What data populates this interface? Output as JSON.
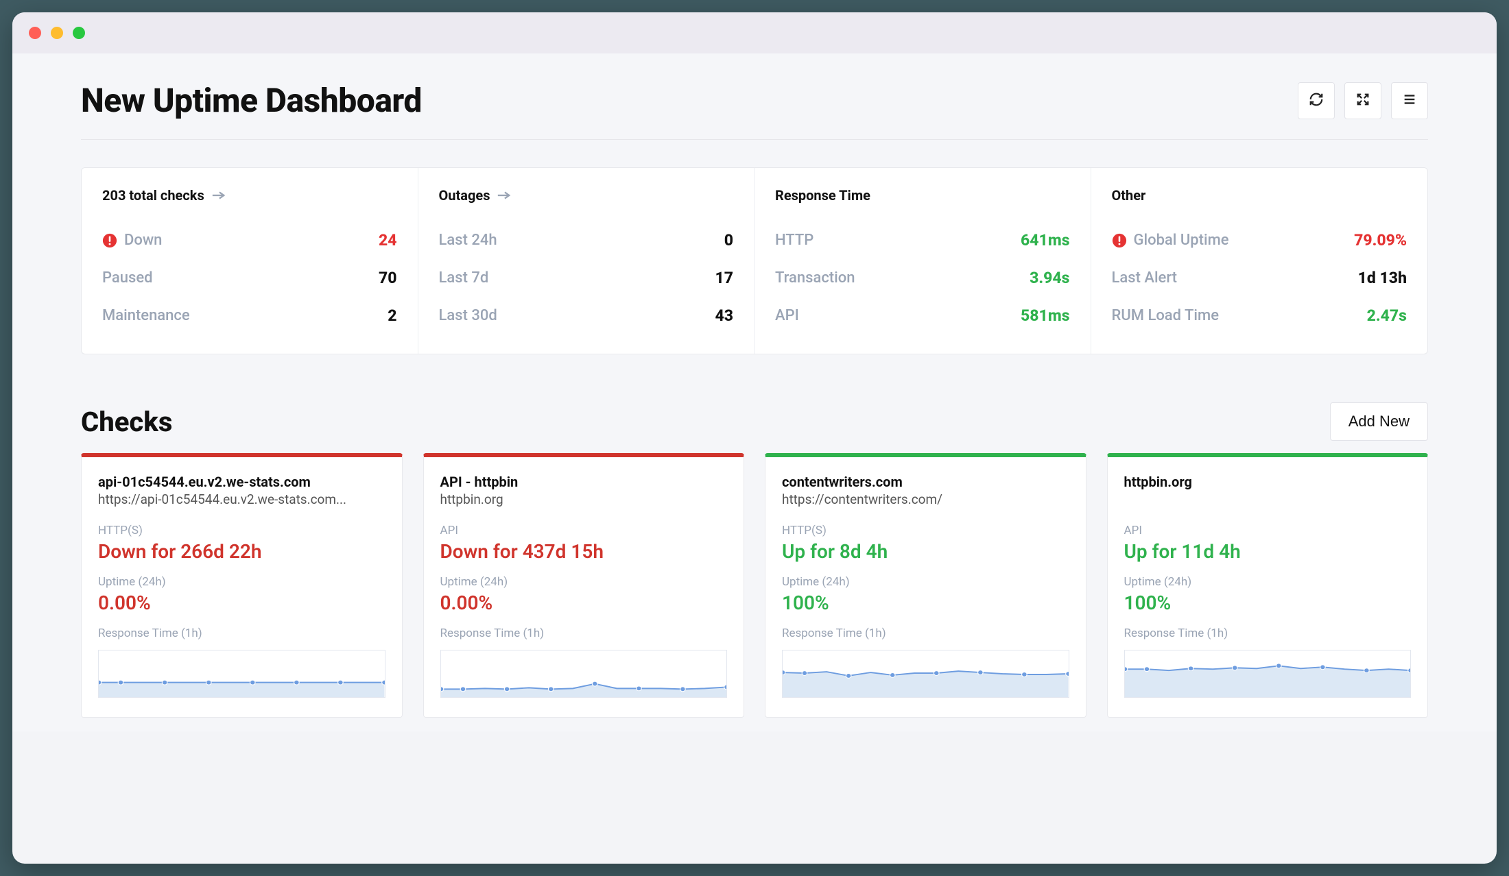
{
  "colors": {
    "red": "#e53333",
    "green": "#2fb24d",
    "down_border": "#d0342c",
    "up_border": "#2fb24d"
  },
  "header": {
    "title": "New Uptime Dashboard"
  },
  "summary": {
    "checks": {
      "title": "203 total checks",
      "rows": [
        {
          "label": "Down",
          "value": "24",
          "alert": true,
          "valueClass": "red"
        },
        {
          "label": "Paused",
          "value": "70"
        },
        {
          "label": "Maintenance",
          "value": "2"
        }
      ]
    },
    "outages": {
      "title": "Outages",
      "rows": [
        {
          "label": "Last 24h",
          "value": "0"
        },
        {
          "label": "Last 7d",
          "value": "17"
        },
        {
          "label": "Last 30d",
          "value": "43"
        }
      ]
    },
    "response": {
      "title": "Response Time",
      "rows": [
        {
          "label": "HTTP",
          "value": "641ms",
          "valueClass": "green"
        },
        {
          "label": "Transaction",
          "value": "3.94s",
          "valueClass": "green"
        },
        {
          "label": "API",
          "value": "581ms",
          "valueClass": "green"
        }
      ]
    },
    "other": {
      "title": "Other",
      "rows": [
        {
          "label": "Global Uptime",
          "value": "79.09%",
          "alert": true,
          "valueClass": "red"
        },
        {
          "label": "Last Alert",
          "value": "1d 13h"
        },
        {
          "label": "RUM Load Time",
          "value": "2.47s",
          "valueClass": "green"
        }
      ]
    }
  },
  "checks_section": {
    "title": "Checks",
    "add_label": "Add New",
    "cards": [
      {
        "status": "down",
        "title": "api-01c54544.eu.v2.we-stats.com",
        "subtitle": "https://api-01c54544.eu.v2.we-stats.com...",
        "type_label": "HTTP(S)",
        "status_text": "Down for 266d 22h",
        "uptime_label": "Uptime (24h)",
        "uptime_value": "0.00%",
        "rt_label": "Response Time (1h)",
        "spark": [
          48,
          48,
          48,
          48,
          48,
          48,
          48,
          48,
          48,
          48,
          48,
          48,
          48,
          48
        ]
      },
      {
        "status": "down",
        "title": "API - httpbin",
        "subtitle": "httpbin.org",
        "type_label": "API",
        "status_text": "Down for 437d 15h",
        "uptime_label": "Uptime (24h)",
        "uptime_value": "0.00%",
        "rt_label": "Response Time (1h)",
        "spark": [
          58,
          58,
          57,
          58,
          56,
          58,
          57,
          50,
          57,
          57,
          57,
          58,
          57,
          55
        ]
      },
      {
        "status": "up",
        "title": "contentwriters.com",
        "subtitle": "https://contentwriters.com/",
        "type_label": "HTTP(S)",
        "status_text": "Up for 8d 4h",
        "uptime_label": "Uptime (24h)",
        "uptime_value": "100%",
        "rt_label": "Response Time (1h)",
        "spark": [
          33,
          34,
          32,
          38,
          33,
          37,
          34,
          34,
          31,
          33,
          35,
          36,
          36,
          35
        ]
      },
      {
        "status": "up",
        "title": "httpbin.org",
        "subtitle": "",
        "type_label": "API",
        "status_text": "Up for 11d 4h",
        "uptime_label": "Uptime (24h)",
        "uptime_value": "100%",
        "rt_label": "Response Time (1h)",
        "spark": [
          28,
          28,
          30,
          27,
          28,
          26,
          27,
          23,
          27,
          25,
          28,
          30,
          28,
          30
        ]
      }
    ]
  },
  "chart_data": [
    {
      "type": "line",
      "title": "Response Time (1h) — api-01c54544.eu.v2.we-stats.com",
      "ylim": [
        0,
        70
      ],
      "values": [
        48,
        48,
        48,
        48,
        48,
        48,
        48,
        48,
        48,
        48,
        48,
        48,
        48,
        48
      ]
    },
    {
      "type": "line",
      "title": "Response Time (1h) — API - httpbin",
      "ylim": [
        0,
        70
      ],
      "values": [
        58,
        58,
        57,
        58,
        56,
        58,
        57,
        50,
        57,
        57,
        57,
        58,
        57,
        55
      ]
    },
    {
      "type": "line",
      "title": "Response Time (1h) — contentwriters.com",
      "ylim": [
        0,
        70
      ],
      "values": [
        33,
        34,
        32,
        38,
        33,
        37,
        34,
        34,
        31,
        33,
        35,
        36,
        36,
        35
      ]
    },
    {
      "type": "line",
      "title": "Response Time (1h) — httpbin.org",
      "ylim": [
        0,
        70
      ],
      "values": [
        28,
        28,
        30,
        27,
        28,
        26,
        27,
        23,
        27,
        25,
        28,
        30,
        28,
        30
      ]
    }
  ]
}
